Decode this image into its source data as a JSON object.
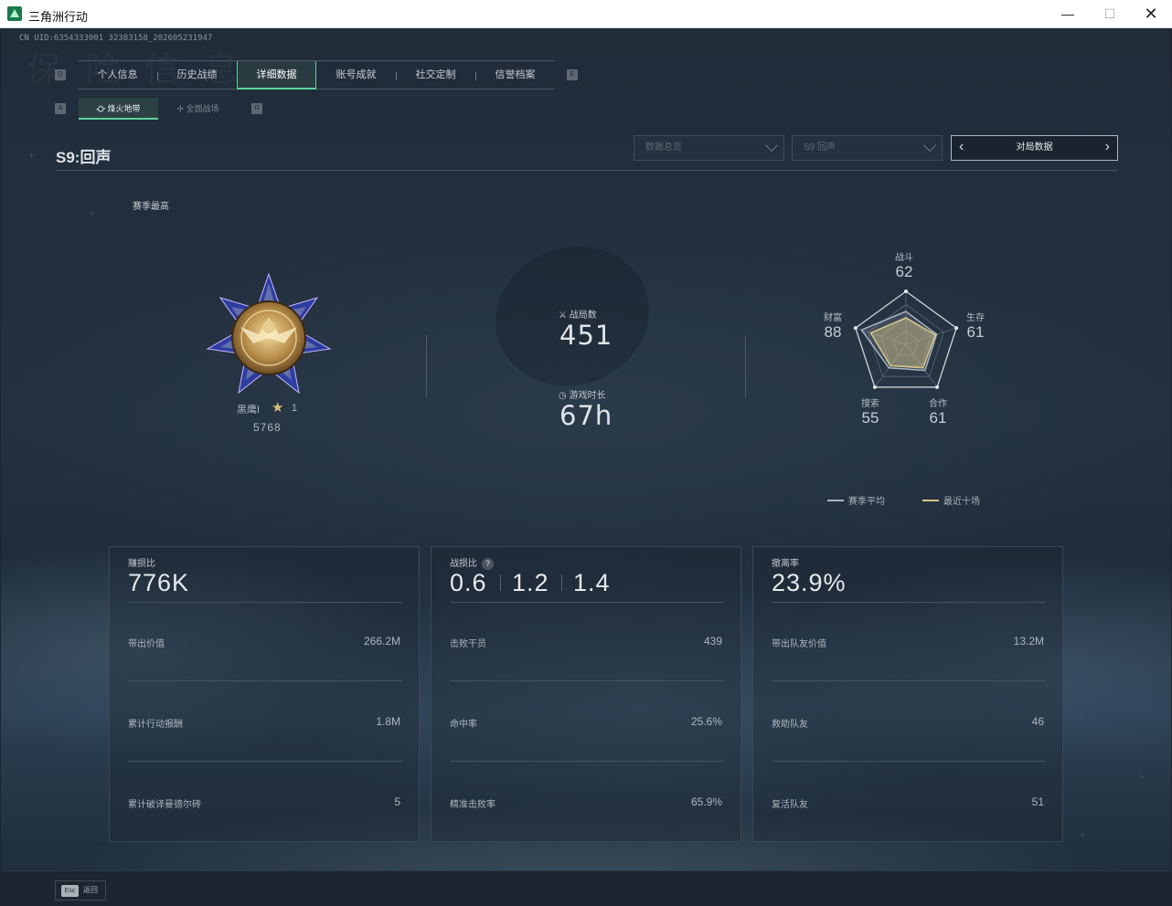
{
  "window": {
    "title": "三角洲行动",
    "minimize": "—",
    "maximize": "☐",
    "close": "✕"
  },
  "uid": "CN UID:6354333001 32383158_202605231947",
  "keys": {
    "q": "Q",
    "e": "E",
    "a": "A",
    "d": "D"
  },
  "main_tabs": [
    {
      "label": "个人信息",
      "active": false
    },
    {
      "label": "历史战绩",
      "active": false
    },
    {
      "label": "详细数据",
      "active": true
    },
    {
      "label": "账号成就",
      "active": false
    },
    {
      "label": "社交定制",
      "active": false
    },
    {
      "label": "信誉档案",
      "active": false
    }
  ],
  "sub_tabs": [
    {
      "label": "烽火地带",
      "active": true
    },
    {
      "label": "全面战场",
      "active": false
    }
  ],
  "season_title": "S9:回声",
  "dropdowns": {
    "data_overview": "数据总览",
    "season": "S9 回声"
  },
  "pager": {
    "label": "对局数据",
    "prev": "‹",
    "next": "›"
  },
  "season_high_label": "赛季最高",
  "rank": {
    "name": "黑鹰I",
    "stars": "1",
    "score": "5768"
  },
  "stats": {
    "matches_label": "战局数",
    "matches_value": "451",
    "playtime_label": "游戏时长",
    "playtime_value": "67h"
  },
  "radar": {
    "axes": [
      {
        "label": "战斗",
        "value": "62"
      },
      {
        "label": "生存",
        "value": "61"
      },
      {
        "label": "合作",
        "value": "61"
      },
      {
        "label": "搜索",
        "value": "55"
      },
      {
        "label": "财富",
        "value": "88"
      }
    ],
    "season_avg": [
      62,
      61,
      61,
      55,
      88
    ],
    "recent_ten": [
      50,
      58,
      55,
      50,
      70
    ],
    "legend_season_avg": "赛季平均",
    "legend_recent_ten": "最近十场",
    "color_avg": "#a8b4c0",
    "color_recent": "#d8c78a"
  },
  "cards": [
    {
      "title": "赚损比",
      "big": "776K",
      "rows": [
        {
          "label": "带出价值",
          "value": "266.2M"
        },
        {
          "label": "累计行动报酬",
          "value": "1.8M"
        },
        {
          "label": "累计破译曼德尔砖",
          "value": "5"
        }
      ]
    },
    {
      "title": "战损比",
      "big_values": [
        "0.6",
        "1.2",
        "1.4"
      ],
      "help": "?",
      "rows": [
        {
          "label": "击败干员",
          "value": "439"
        },
        {
          "label": "命中率",
          "value": "25.6%"
        },
        {
          "label": "精准击败率",
          "value": "65.9%"
        }
      ]
    },
    {
      "title": "撤离率",
      "big": "23.9%",
      "rows": [
        {
          "label": "带出队友价值",
          "value": "13.2M"
        },
        {
          "label": "救助队友",
          "value": "46"
        },
        {
          "label": "复活队友",
          "value": "51"
        }
      ]
    }
  ],
  "bottom": {
    "esc_key": "Esc",
    "esc_label": "返回"
  }
}
